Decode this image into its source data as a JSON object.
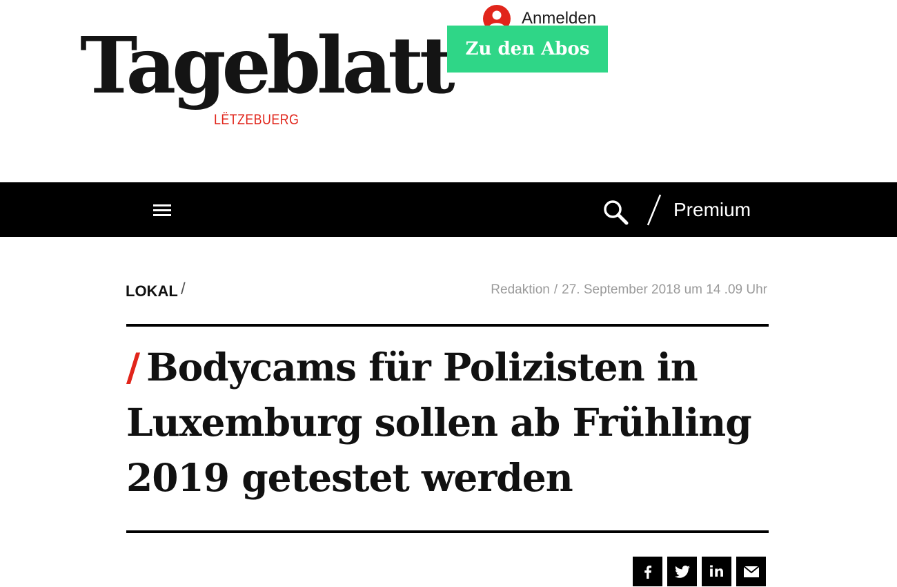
{
  "header": {
    "logo_text": "Tageblatt",
    "logo_sub": "LËTZEBUERG",
    "login_label": "Anmelden",
    "cta_label": "Zu den Abos"
  },
  "nav": {
    "premium_label": "Premium",
    "menu_icon": "hamburger-menu-icon",
    "search_icon": "magnifier-icon"
  },
  "article": {
    "category": "LOKAL",
    "category_separator": "/",
    "author": "Redaktion",
    "meta_separator": "/",
    "date": "27. September 2018 um 14 .09 Uhr",
    "headline_marker": "/",
    "headline": "Bodycams für Polizisten in Luxemburg sollen ab Frühling 2019 getestet werden"
  },
  "share": {
    "facebook_icon": "facebook-icon",
    "twitter_icon": "twitter-icon",
    "linkedin_icon": "linkedin-icon",
    "linkedin_text": "in",
    "email_icon": "email-icon"
  },
  "colors": {
    "brand_red": "#e1251b",
    "cta_green": "#2fd687",
    "nav_background": "#000000",
    "meta_gray": "#9a9a9a"
  }
}
